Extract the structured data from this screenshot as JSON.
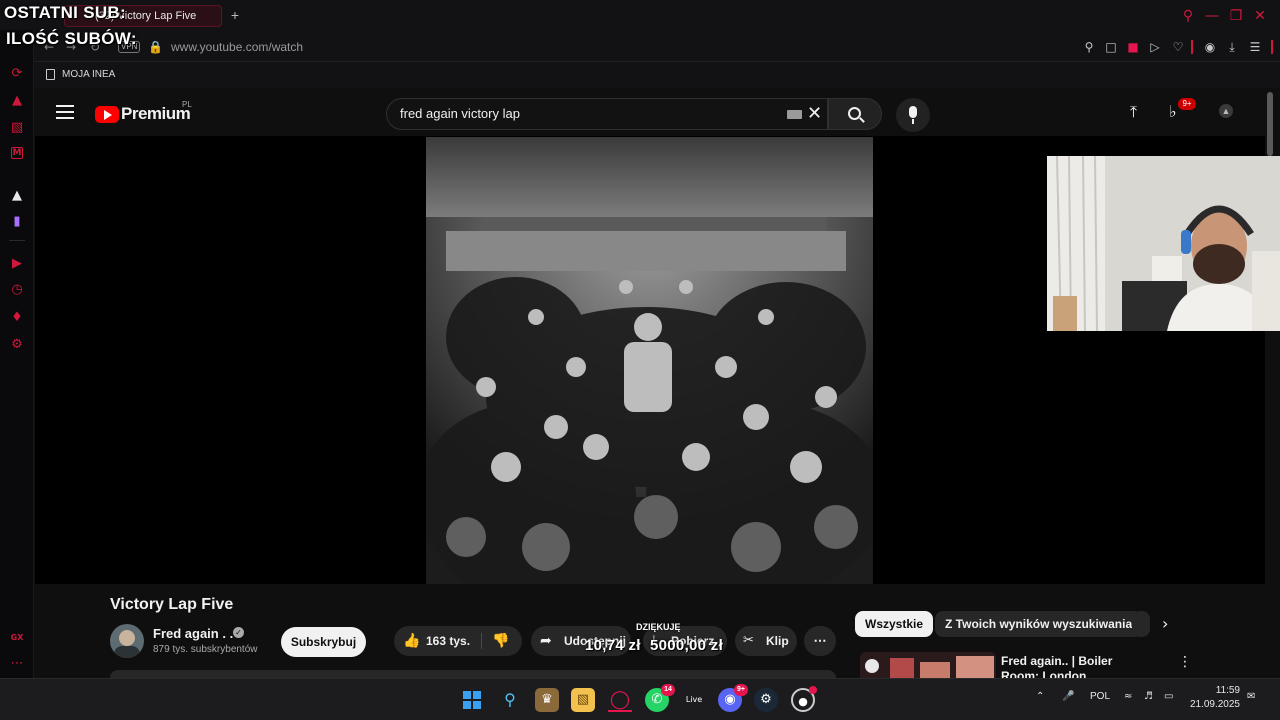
{
  "overlay": {
    "line1": "OSTATNI SUB:",
    "line2": "ILOŚĆ SUBÓW:"
  },
  "browser": {
    "tab_title": "(32) Victory Lap Five",
    "tab_partial": "(32) Victory Lap Five",
    "new_tab": "+",
    "vpn_label": "VPN",
    "url": "www.youtube.com/watch",
    "bookmark": "MOJA INEA"
  },
  "youtube": {
    "logo_text": "Premium",
    "logo_region": "PL",
    "search_value": "fred again victory lap",
    "notif_count": "9+",
    "video_title": "Victory Lap Five",
    "channel_name": "Fred again . .",
    "channel_subs": "879 tys. subskrybentów",
    "subscribe_label": "Subskrybuj",
    "likes_label": "163 tys.",
    "share_label": "Udostępnij",
    "download_label": "Pobierz",
    "clip_label": "Klip",
    "chips": [
      "Wszystkie",
      "Z Twoich wyników wyszukiwania"
    ],
    "recommended_title": "Fred again.. | Boiler Room: London"
  },
  "donation": {
    "header": "DZIĘKUJĘ",
    "current": "10,74 zł",
    "goal": "5000,00 zł"
  },
  "taskbar": {
    "whatsapp_badge": "14",
    "discord_badge": "9+",
    "language": "POL",
    "time": "11:59",
    "date": "21.09.2025"
  },
  "colors": {
    "accent_gx": "#d0183c",
    "youtube_red": "#ff0000",
    "yt_bg": "#0f0f0f"
  }
}
